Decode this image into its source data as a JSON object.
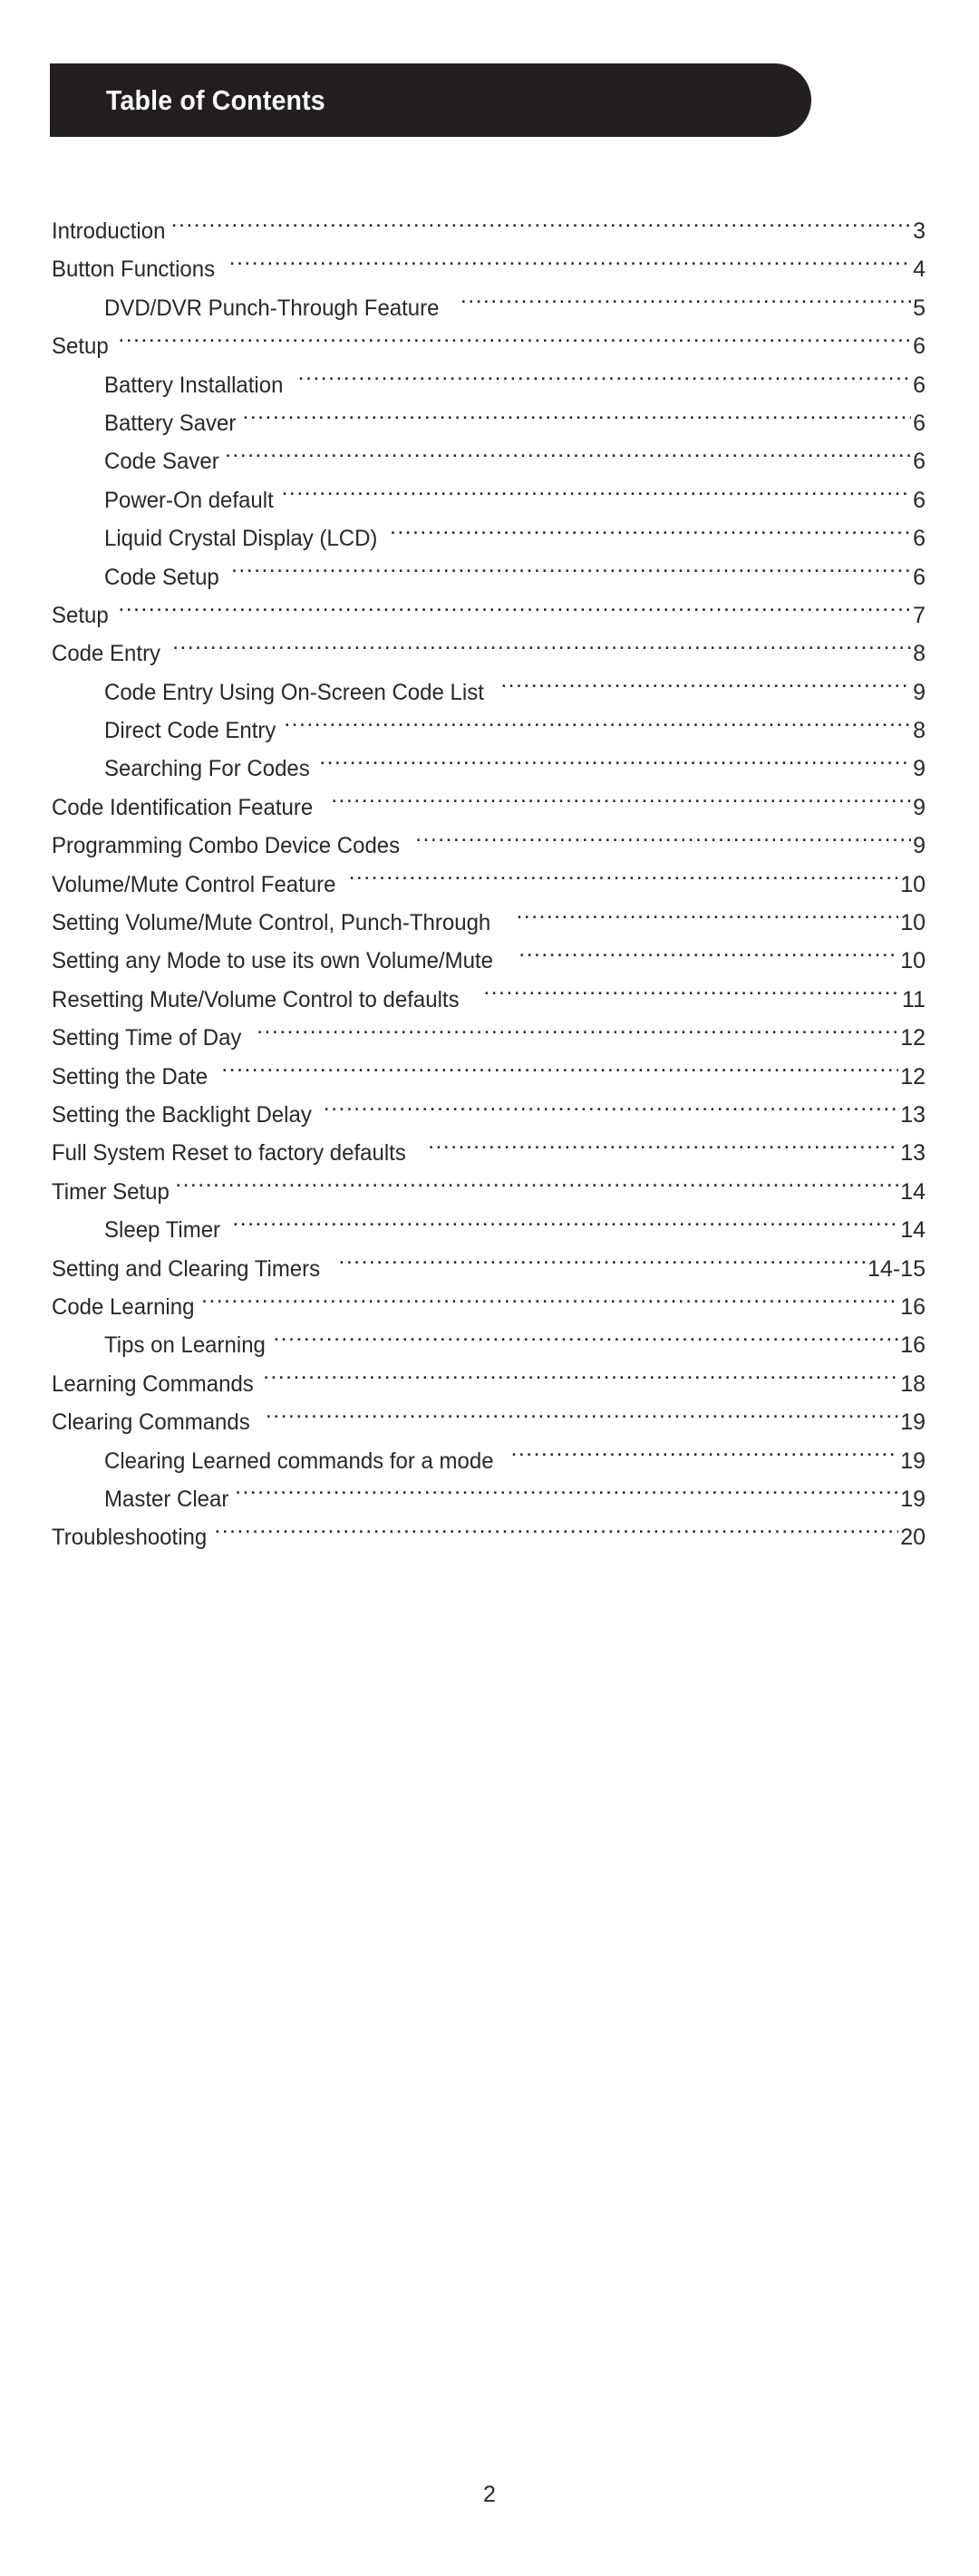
{
  "document": {
    "header": {
      "title": "Table of Contents",
      "banner_color": "#231f20",
      "text_color": "#ffffff"
    },
    "footer": {
      "page_number": "2"
    },
    "toc": {
      "entries": [
        {
          "title": "Introduction",
          "page": "3",
          "level": 1,
          "gap": false
        },
        {
          "title": "Button Functions",
          "page": "4",
          "level": 1,
          "gap": true
        },
        {
          "title": "DVD/DVR Punch-Through Feature",
          "page": "5",
          "level": 2,
          "gap": true
        },
        {
          "title": "Setup",
          "page": "6",
          "level": 1,
          "gap": true
        },
        {
          "title": "Battery Installation",
          "page": "6",
          "level": 2,
          "gap": true
        },
        {
          "title": "Battery Saver",
          "page": "6",
          "level": 2,
          "gap": false
        },
        {
          "title": "Code Saver",
          "page": "6",
          "level": 2,
          "gap": false
        },
        {
          "title": "Power-On default",
          "page": "6",
          "level": 2,
          "gap": false
        },
        {
          "title": "Liquid Crystal Display (LCD)",
          "page": "6",
          "level": 2,
          "gap": false
        },
        {
          "title": "Code Setup",
          "page": "6",
          "level": 2,
          "gap": true
        },
        {
          "title": "Setup",
          "page": "7",
          "level": 1,
          "gap": true
        },
        {
          "title": "Code Entry",
          "page": "8",
          "level": 1,
          "gap": true
        },
        {
          "title": "Code Entry Using On-Screen Code List",
          "page": "9",
          "level": 2,
          "gap": false
        },
        {
          "title": "Direct Code Entry",
          "page": "8",
          "level": 2,
          "gap": false
        },
        {
          "title": "Searching For Codes",
          "page": "9",
          "level": 2,
          "gap": false
        },
        {
          "title": "Code Identification Feature",
          "page": "9",
          "level": 1,
          "gap": true
        },
        {
          "title": "Programming Combo Device Codes",
          "page": "9",
          "level": 1,
          "gap": false
        },
        {
          "title": "Volume/Mute Control Feature",
          "page": "10",
          "level": 1,
          "gap": false
        },
        {
          "title": "Setting Volume/Mute Control, Punch-Through",
          "page": "10",
          "level": 1,
          "gap": true
        },
        {
          "title": "Setting any Mode to use its own Volume/Mute",
          "page": "10",
          "level": 1,
          "gap": true
        },
        {
          "title": "Resetting Mute/Volume Control to defaults",
          "page": "11",
          "level": 1,
          "gap": true
        },
        {
          "title": "Setting Time of Day",
          "page": "12",
          "level": 1,
          "gap": true
        },
        {
          "title": "Setting the Date",
          "page": "12",
          "level": 1,
          "gap": true
        },
        {
          "title": "Setting the Backlight Delay",
          "page": "13",
          "level": 1,
          "gap": false
        },
        {
          "title": "Full System Reset to factory defaults",
          "page": "13",
          "level": 1,
          "gap": true
        },
        {
          "title": "Timer Setup",
          "page": "14",
          "level": 1,
          "gap": false
        },
        {
          "title": "Sleep Timer",
          "page": "14",
          "level": 2,
          "gap": true
        },
        {
          "title": "Setting and Clearing Timers",
          "page": "14-15",
          "level": 1,
          "gap": true
        },
        {
          "title": "Code Learning",
          "page": "16",
          "level": 1,
          "gap": false
        },
        {
          "title": "Tips on Learning",
          "page": "16",
          "level": 2,
          "gap": false
        },
        {
          "title": "Learning Commands",
          "page": "18",
          "level": 1,
          "gap": false
        },
        {
          "title": "Clearing Commands",
          "page": "19",
          "level": 1,
          "gap": true
        },
        {
          "title": "Clearing Learned commands for a mode",
          "page": "19",
          "level": 2,
          "gap": false
        },
        {
          "title": "Master Clear",
          "page": "19",
          "level": 2,
          "gap": false
        },
        {
          "title": "Troubleshooting",
          "page": "20",
          "level": 1,
          "gap": false
        }
      ]
    }
  }
}
